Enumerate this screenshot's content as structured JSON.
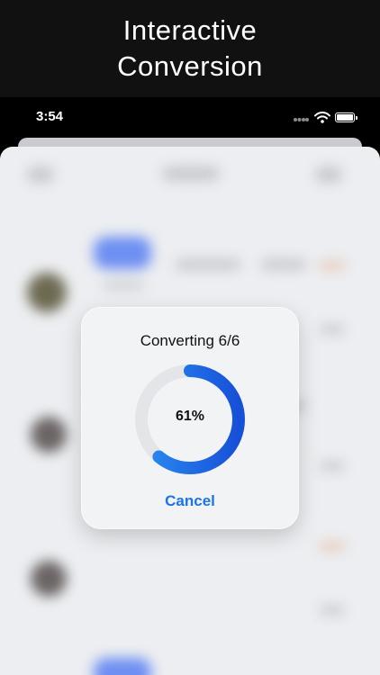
{
  "promo": {
    "title_line1": "Interactive",
    "title_line2": "Conversion"
  },
  "status_bar": {
    "time": "3:54"
  },
  "dialog": {
    "title": "Converting 6/6",
    "progress": 0.61,
    "progress_label": "61%",
    "cancel_label": "Cancel"
  },
  "colors": {
    "accent": "#1a73e8",
    "ring_start": "#2a8cf0",
    "ring_end": "#1750d8",
    "ring_track": "#e3e5e9"
  },
  "icons": [
    "signal-icon",
    "wifi-icon",
    "battery-icon"
  ]
}
